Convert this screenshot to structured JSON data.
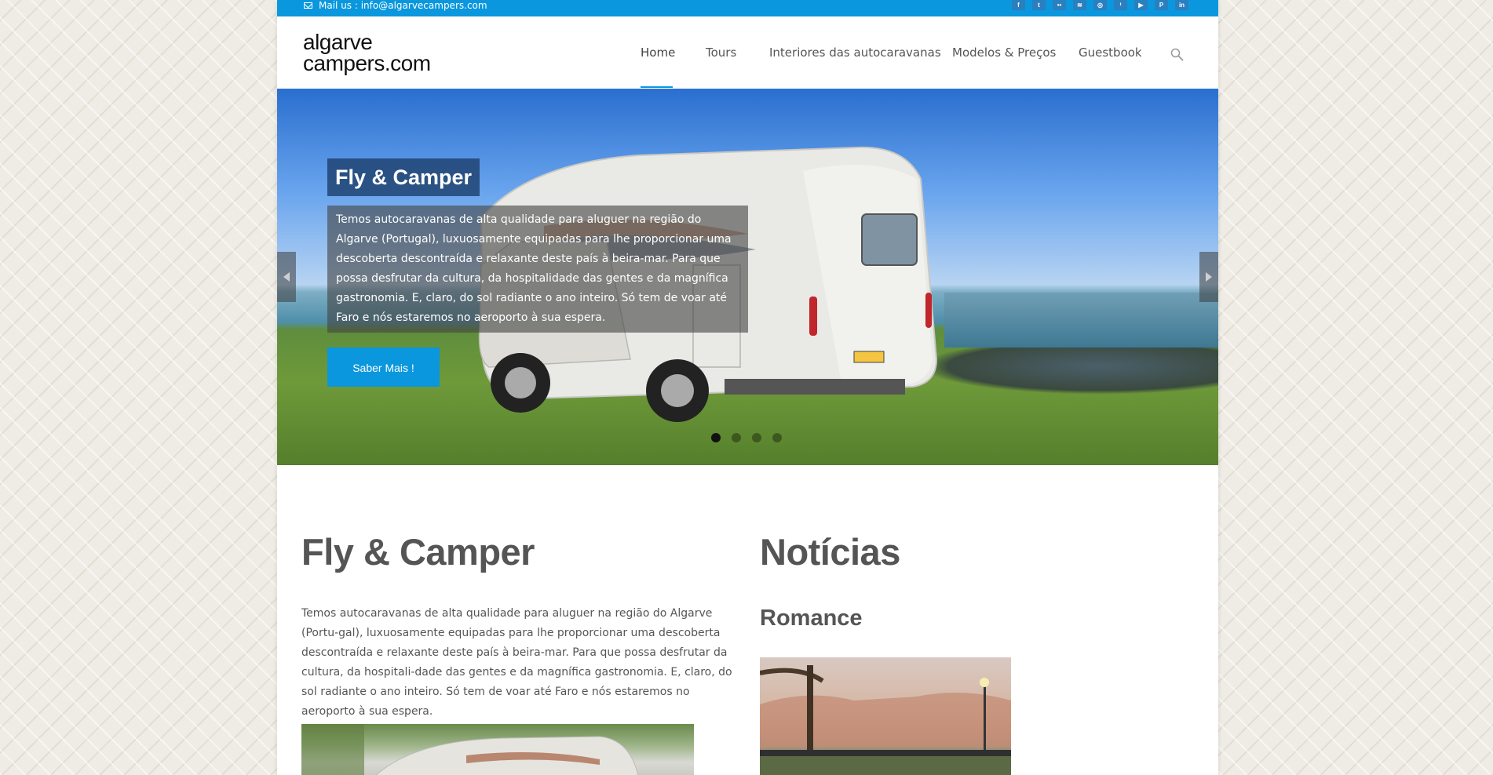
{
  "topbar": {
    "mail": "Mail us : info@algarvecampers.com",
    "social": [
      {
        "icon": "facebook-icon",
        "glyph": "f"
      },
      {
        "icon": "twitter-icon",
        "glyph": "t"
      },
      {
        "icon": "flickr-icon",
        "glyph": "••"
      },
      {
        "icon": "rss-icon",
        "glyph": "≋"
      },
      {
        "icon": "instagram-icon",
        "glyph": "◎"
      },
      {
        "icon": "tumblr-icon",
        "glyph": "ᵗ"
      },
      {
        "icon": "youtube-icon",
        "glyph": "▶"
      },
      {
        "icon": "pinterest-icon",
        "glyph": "P"
      },
      {
        "icon": "linkedin-icon",
        "glyph": "in"
      }
    ]
  },
  "header": {
    "logo_line1": "algarve",
    "logo_line2": "campers.com",
    "nav": [
      {
        "label": "Home",
        "active": true
      },
      {
        "label": "Tours"
      },
      {
        "label": "Interiores das autocaravanas"
      },
      {
        "label": "Modelos & Preços"
      },
      {
        "label": "Guestbook"
      }
    ]
  },
  "slider": {
    "title": "Fly & Camper",
    "text": "Temos autocaravanas de alta qualidade para aluguer na região do Algarve (Portugal), luxuosamente equipadas para lhe proporcionar uma descoberta descontraída e relaxante deste país à beira-mar. Para que possa desfrutar da cultura, da hospitalidade das gentes e da magnífica gastronomia. E, claro, do sol radiante o ano inteiro. Só tem de voar até Faro e nós estaremos no aeroporto à sua espera.",
    "button": "Saber Mais !",
    "dots": 4,
    "active_dot": 1
  },
  "content": {
    "left_title": "Fly & Camper",
    "left_text": "Temos autocaravanas de alta qualidade para aluguer na região do Algarve (Portu-gal), luxuosamente equipadas para lhe proporcionar uma descoberta descontraída e relaxante deste país à beira-mar. Para que possa desfrutar da cultura, da hospitali-dade das gentes e da magnífica gastronomia. E, claro, do sol radiante o ano inteiro. Só tem de voar até Faro e nós estaremos no aeroporto à sua espera.",
    "right_title": "Notícias",
    "right_subtitle": "Romance"
  },
  "colors": {
    "accent": "#0a97de",
    "text": "#555555"
  }
}
